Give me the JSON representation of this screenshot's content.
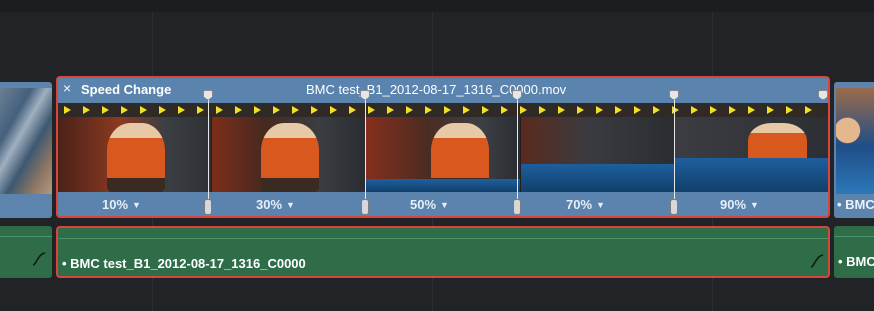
{
  "clip": {
    "close_icon": "×",
    "title": "Speed Change",
    "filename": "BMC test_B1_2012-08-17_1316_C0000.mov",
    "speed_points": [
      "10%",
      "30%",
      "50%",
      "70%",
      "90%"
    ]
  },
  "neighbor_clip": {
    "name": "• BMC"
  },
  "audio": {
    "clip_name": "• BMC test_B1_2012-08-17_1316_C0000",
    "neighbor_name": "• BMC"
  },
  "colors": {
    "video_clip": "#5a83ad",
    "audio_clip": "#2e6d47",
    "selection_border": "#d9453c",
    "speed_arrow": "#f1df2a"
  },
  "icons": {
    "close": "close-icon",
    "dropdown": "caret-down-icon",
    "audio_curve": "audio-curve-icon"
  }
}
